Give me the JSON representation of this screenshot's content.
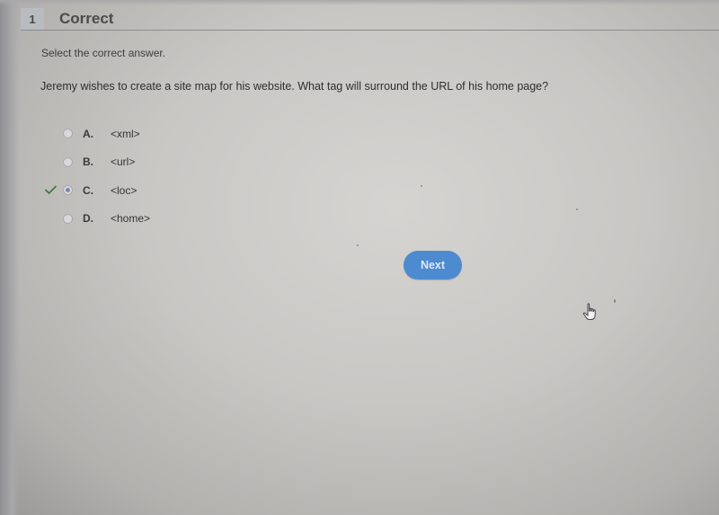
{
  "header": {
    "question_number": "1",
    "status": "Correct"
  },
  "instruction": "Select the correct answer.",
  "question": "Jeremy wishes to create a site map for his website. What tag will surround the URL of his home page?",
  "options": [
    {
      "letter": "A.",
      "text": "<xml>",
      "selected": false,
      "correct_mark": false
    },
    {
      "letter": "B.",
      "text": "<url>",
      "selected": false,
      "correct_mark": false
    },
    {
      "letter": "C.",
      "text": "<loc>",
      "selected": true,
      "correct_mark": true
    },
    {
      "letter": "D.",
      "text": "<home>",
      "selected": false,
      "correct_mark": false
    }
  ],
  "next_button": {
    "label": "Next",
    "color": "#4c8bd0"
  },
  "colors": {
    "correct_check": "#3f7a3f",
    "radio_selected": "#7d86ad"
  }
}
